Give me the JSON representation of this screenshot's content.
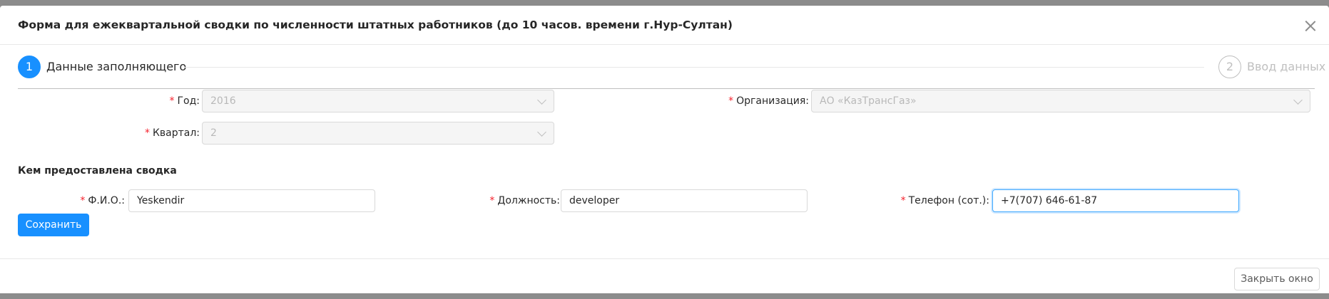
{
  "modal": {
    "title": "Форма для ежеквартальной сводки по численности штатных работников (до 10 часов. времени г.Нур-Султан)"
  },
  "steps": [
    {
      "number": "1",
      "label": "Данные заполняющего",
      "status": "active"
    },
    {
      "number": "2",
      "label": "Ввод данных",
      "status": "wait"
    }
  ],
  "form": {
    "required_mark": "*",
    "year": {
      "label": "Год",
      "value": "2016"
    },
    "organization": {
      "label": "Организация",
      "value": "АО «КазТрансГаз»"
    },
    "quarter": {
      "label": "Квартал",
      "value": "2"
    },
    "section_title": "Кем предоставлена сводка",
    "fio": {
      "label": "Ф.И.О.",
      "value": "Yeskendir"
    },
    "position": {
      "label": "Должность",
      "value": "developer"
    },
    "phone": {
      "label": "Телефон (сот.)",
      "value": "+7(707) 646-61-87"
    },
    "save_label": "Сохранить"
  },
  "footer": {
    "close_label": "Закрыть окно"
  },
  "colors": {
    "primary": "#1890ff",
    "required": "#f5222d",
    "overlay": "#8c8c8c"
  },
  "icons": {
    "close": "close-icon",
    "select_arrow": "chevron-down-icon"
  }
}
